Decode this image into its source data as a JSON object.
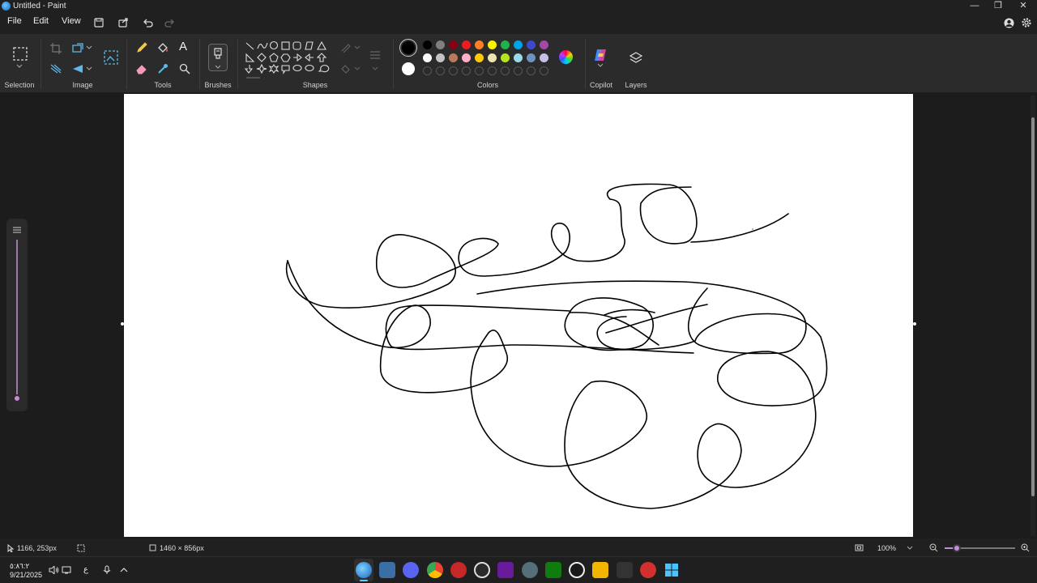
{
  "window": {
    "title": "Untitled - Paint",
    "minimize": "—",
    "maximize": "❐",
    "close": "✕"
  },
  "menu": {
    "file": "File",
    "edit": "Edit",
    "view": "View"
  },
  "ribbon": {
    "groups": {
      "selection": "Selection",
      "image": "Image",
      "tools": "Tools",
      "brushes": "Brushes",
      "shapes": "Shapes",
      "colors": "Colors",
      "copilot": "Copilot",
      "layers": "Layers"
    },
    "tools_text_glyph": "A",
    "colors": {
      "primary": "#000000",
      "secondary": "#ffffff",
      "row1": [
        "#000000",
        "#7f7f7f",
        "#880015",
        "#ed1c24",
        "#ff7f27",
        "#fff200",
        "#22b14c",
        "#00a2e8",
        "#3f48cc",
        "#a349a4"
      ],
      "row2": [
        "#ffffff",
        "#c3c3c3",
        "#b97a57",
        "#ffaec9",
        "#ffc90e",
        "#efe4b0",
        "#b5e61d",
        "#99d9ea",
        "#7092be",
        "#c8bfe7"
      ]
    }
  },
  "status": {
    "cursor_position": "1166, 253px",
    "canvas_size": "1460 × 856px",
    "zoom": "100%"
  },
  "taskbar": {
    "time": "٥:٨٦:٢",
    "date": "9/21/2025",
    "lang": "ع"
  }
}
